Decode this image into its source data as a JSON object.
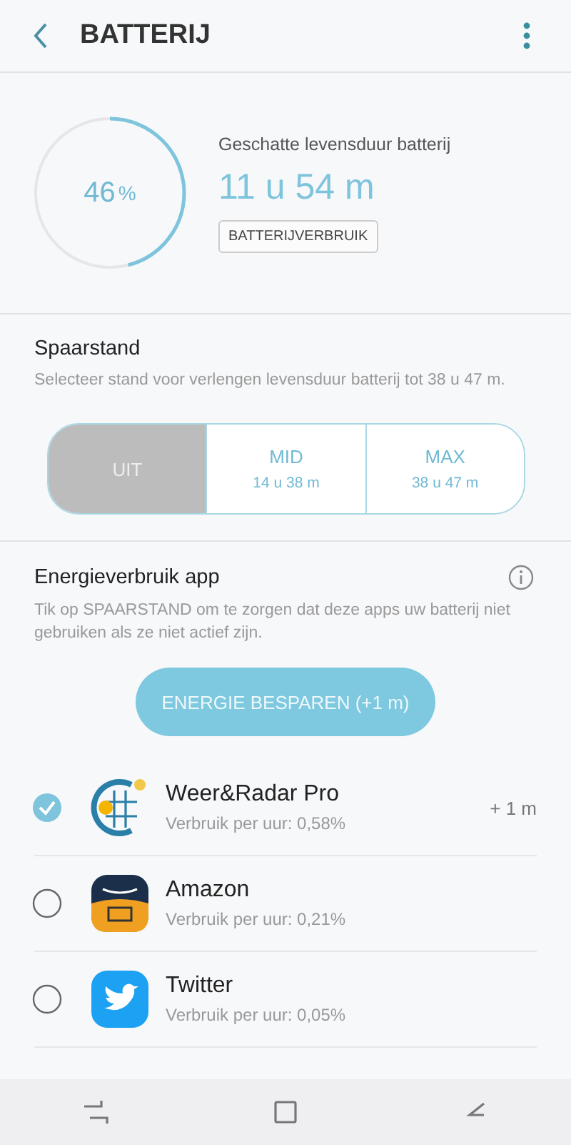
{
  "header": {
    "title": "BATTERIJ"
  },
  "battery": {
    "level": 0.46,
    "percent": "46",
    "unit": "%",
    "estimate_label": "Geschatte levensduur batterij",
    "estimate": "11 u 54 m",
    "usage_button": "BATTERIJVERBRUIK"
  },
  "power_saving": {
    "title": "Spaarstand",
    "description": "Selecteer stand voor verlengen levensduur batterij tot 38 u 47 m.",
    "modes": [
      {
        "label": "UIT",
        "selected": true
      },
      {
        "label": "MID",
        "detail": "14 u 38 m",
        "selected": false
      },
      {
        "label": "MAX",
        "detail": "38 u 47 m",
        "selected": false
      }
    ]
  },
  "app_usage": {
    "title": "Energieverbruik app",
    "description": "Tik op SPAARSTAND om te zorgen dat deze apps uw batterij niet gebruiken als ze niet actief zijn.",
    "save_button": "ENERGIE BESPAREN (+1 m)",
    "apps": [
      {
        "name": "Weer&Radar Pro",
        "usage": "Verbruik per uur: 0,58%",
        "gain": "+ 1 m",
        "checked": true
      },
      {
        "name": "Amazon",
        "usage": "Verbruik per uur: 0,21%",
        "checked": false
      },
      {
        "name": "Twitter",
        "usage": "Verbruik per uur: 0,05%",
        "checked": false
      }
    ]
  }
}
